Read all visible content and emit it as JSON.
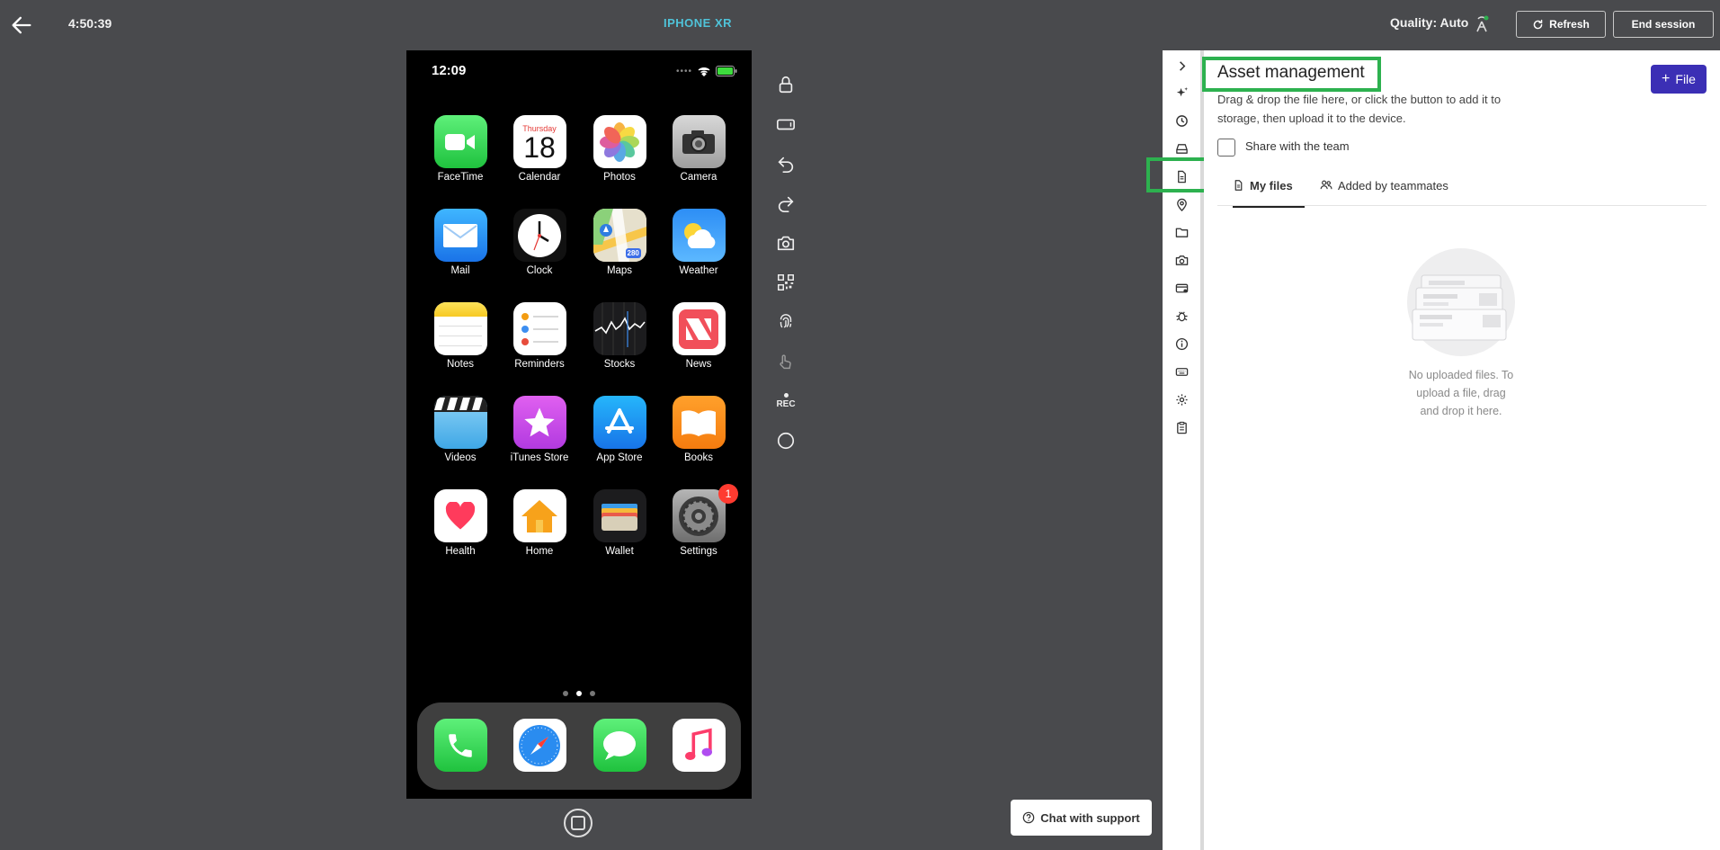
{
  "header": {
    "timer": "4:50:39",
    "device_name": "IPHONE XR",
    "quality_label": "Quality: Auto",
    "refresh_label": "Refresh",
    "end_session_label": "End session"
  },
  "phone": {
    "status_time": "12:09",
    "apps": [
      {
        "label": "FaceTime"
      },
      {
        "label": "Calendar"
      },
      {
        "label": "Photos"
      },
      {
        "label": "Camera"
      },
      {
        "label": "Mail"
      },
      {
        "label": "Clock"
      },
      {
        "label": "Maps"
      },
      {
        "label": "Weather"
      },
      {
        "label": "Notes"
      },
      {
        "label": "Reminders"
      },
      {
        "label": "Stocks"
      },
      {
        "label": "News"
      },
      {
        "label": "Videos"
      },
      {
        "label": "iTunes Store"
      },
      {
        "label": "App Store"
      },
      {
        "label": "Books"
      },
      {
        "label": "Health"
      },
      {
        "label": "Home"
      },
      {
        "label": "Wallet"
      },
      {
        "label": "Settings"
      }
    ],
    "calendar_day": "Thursday",
    "calendar_date": "18",
    "maps_badge": "280",
    "settings_badge": "1",
    "toolbar_rec_label": "REC"
  },
  "chat": {
    "label": "Chat with support"
  },
  "panel": {
    "title": "Asset management",
    "description": "Drag & drop the file here, or click the button to add it to storage, then upload it to the device.",
    "file_button_label": "File",
    "share_label": "Share with the team",
    "tabs": [
      {
        "label": "My files"
      },
      {
        "label": "Added by teammates"
      }
    ],
    "empty_text": "No uploaded files. To upload a file, drag and drop it here."
  },
  "colors": {
    "background": "#494a4d",
    "accent_device": "#4fc3d9",
    "file_button": "#3b2fb5",
    "highlight": "#2db14f"
  }
}
